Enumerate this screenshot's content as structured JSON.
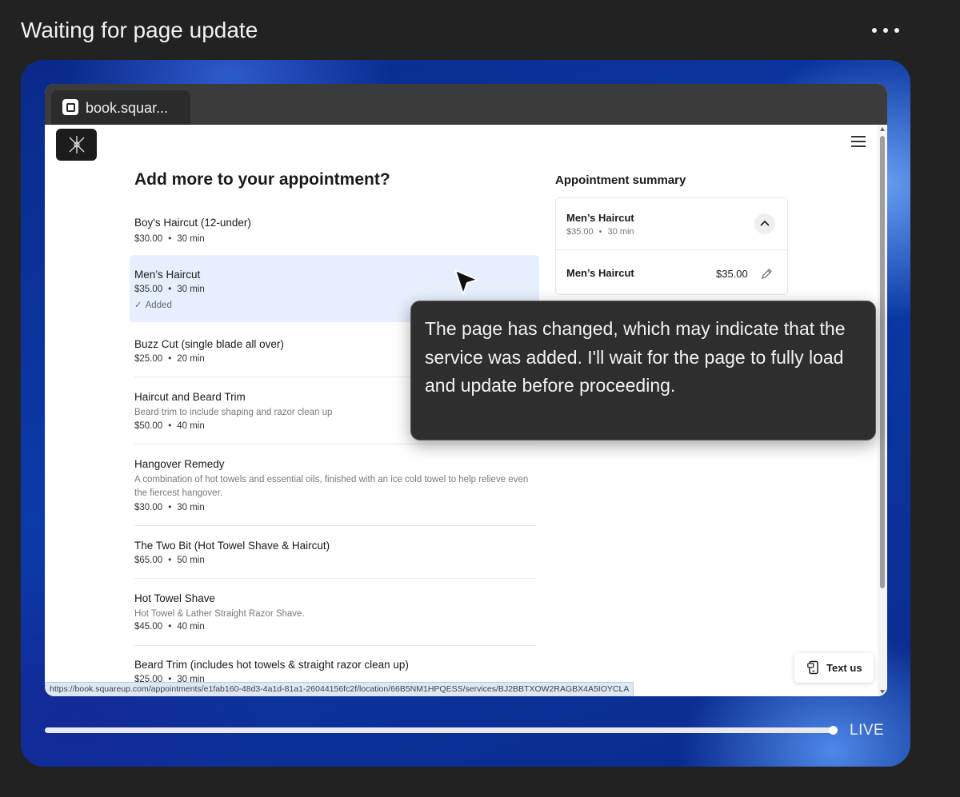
{
  "header": {
    "title": "Waiting for page update"
  },
  "browser_tab": {
    "title": "book.squar..."
  },
  "page": {
    "heading": "Add more to your appointment?",
    "services": [
      {
        "name": "Boy's Haircut (12-under)",
        "price": "$30.00",
        "duration": "30 min"
      },
      {
        "name": "Men’s Haircut",
        "price": "$35.00",
        "duration": "30 min",
        "status": "Added"
      },
      {
        "name": "Buzz Cut (single blade all over)",
        "price": "$25.00",
        "duration": "20 min"
      },
      {
        "name": "Haircut and Beard Trim",
        "description": "Beard trim to include shaping and razor clean up",
        "price": "$50.00",
        "duration": "40 min"
      },
      {
        "name": "Hangover Remedy",
        "description": "A combination of hot towels and essential oils, finished with an ice cold towel to help relieve even the fiercest hangover.",
        "price": "$30.00",
        "duration": "30 min"
      },
      {
        "name": "The Two Bit (Hot Towel Shave & Haircut)",
        "price": "$65.00",
        "duration": "50 min"
      },
      {
        "name": "Hot Towel Shave",
        "description": "Hot Towel & Lather Straight Razor Shave.",
        "price": "$45.00",
        "duration": "40 min"
      },
      {
        "name": "Beard Trim (includes hot towels & straight razor clean up)",
        "price": "$25.00",
        "duration": "30 min"
      }
    ],
    "summary": {
      "heading": "Appointment summary",
      "service_name": "Men’s Haircut",
      "service_price": "$35.00",
      "service_duration": "30 min",
      "item_name": "Men’s Haircut",
      "item_price": "$35.00"
    },
    "text_us_label": "Text us",
    "status_url": "https://book.squareup.com/appointments/e1fab160-48d3-4a1d-81a1-26044156fc2f/location/66B5NM1HPQESS/services/BJ2BBTXOW2RAGBX4A5IOYCLA"
  },
  "tooltip": {
    "text": "The page has changed, which may indicate that the service was added. I'll wait for the page to fully load and update before proceeding."
  },
  "player": {
    "live_label": "LIVE",
    "progress": 1.0
  },
  "icons": [
    "more-icon",
    "tab-favicon-icon",
    "logo-icon",
    "menu-icon",
    "check-icon",
    "chevron-up-icon",
    "pencil-icon",
    "text-us-icon",
    "cursor-icon"
  ],
  "colors": {
    "selected_row": "#e6effd",
    "stage_blue": "#0b3aa9",
    "tooltip_bg": "#2e2e2e"
  }
}
